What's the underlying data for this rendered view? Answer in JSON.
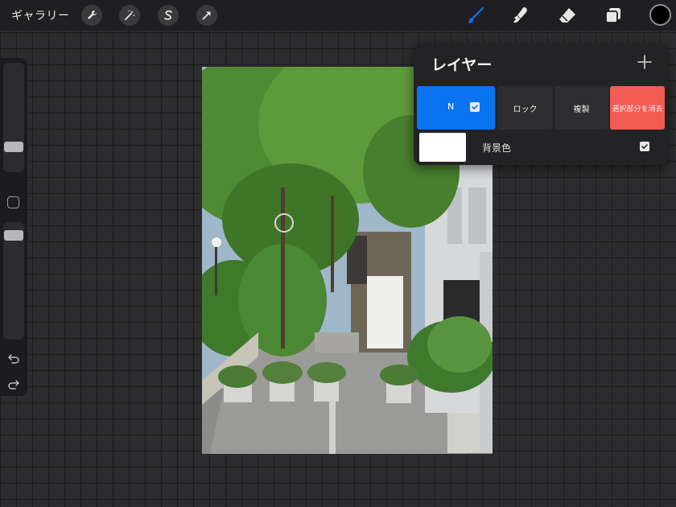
{
  "topbar": {
    "gallery_label": "ギャラリー",
    "left_tools": [
      "wrench-icon",
      "magic-wand-icon",
      "selection-s-icon",
      "arrow-icon"
    ],
    "right_tools": [
      "brush-icon",
      "smudge-icon",
      "eraser-icon",
      "layers-icon"
    ],
    "current_color": "#000000",
    "accent_color": "#0a74f0"
  },
  "sidebar": {
    "size_slider_value": 0.25,
    "opacity_slider_value": 0.05
  },
  "layers": {
    "title": "レイヤー",
    "active_layer": {
      "name": "N",
      "visible": true
    },
    "actions": {
      "lock": "ロック",
      "duplicate": "複製",
      "clear": "選択部分を消去"
    },
    "background": {
      "label": "背景色",
      "color": "#ffffff",
      "visible": true
    }
  },
  "canvas": {
    "content": "street photo"
  }
}
